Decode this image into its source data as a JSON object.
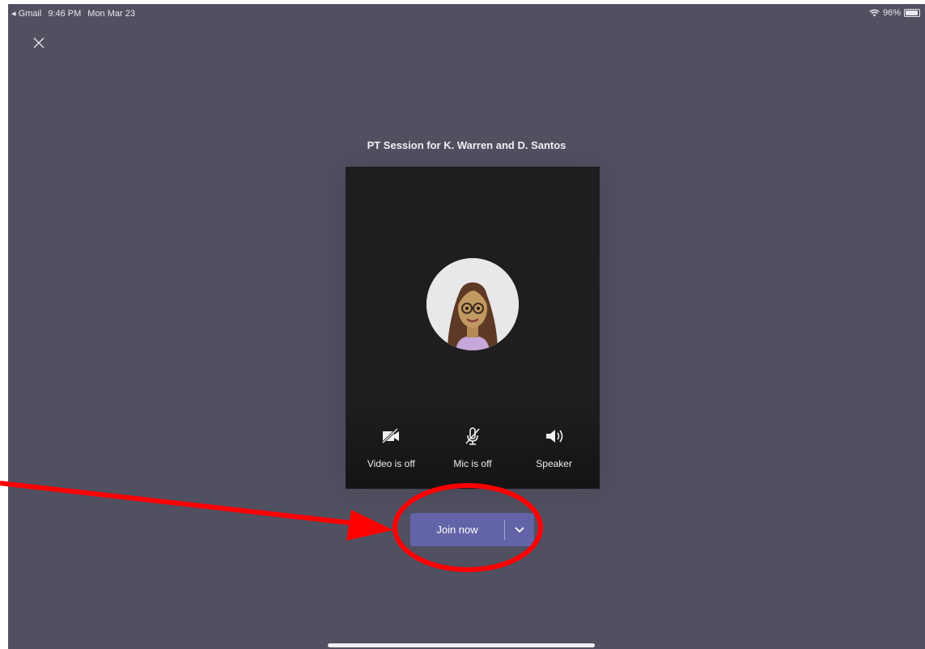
{
  "status_bar": {
    "back_app": "◂ Gmail",
    "time": "9:46 PM",
    "date": "Mon Mar 23",
    "battery": "96%",
    "battery_level": 0.96
  },
  "meeting": {
    "title": "PT Session for K. Warren and D. Santos"
  },
  "controls": [
    {
      "label": "Video is off",
      "icon": "video-off-icon"
    },
    {
      "label": "Mic is off",
      "icon": "mic-off-icon"
    },
    {
      "label": "Speaker",
      "icon": "speaker-icon"
    }
  ],
  "join": {
    "label": "Join now",
    "dropdown_icon": "chevron-down-icon"
  },
  "colors": {
    "background": "#515061",
    "preview": "#1e1d1f",
    "accent": "#6264a7",
    "annotation": "#ff0000"
  }
}
